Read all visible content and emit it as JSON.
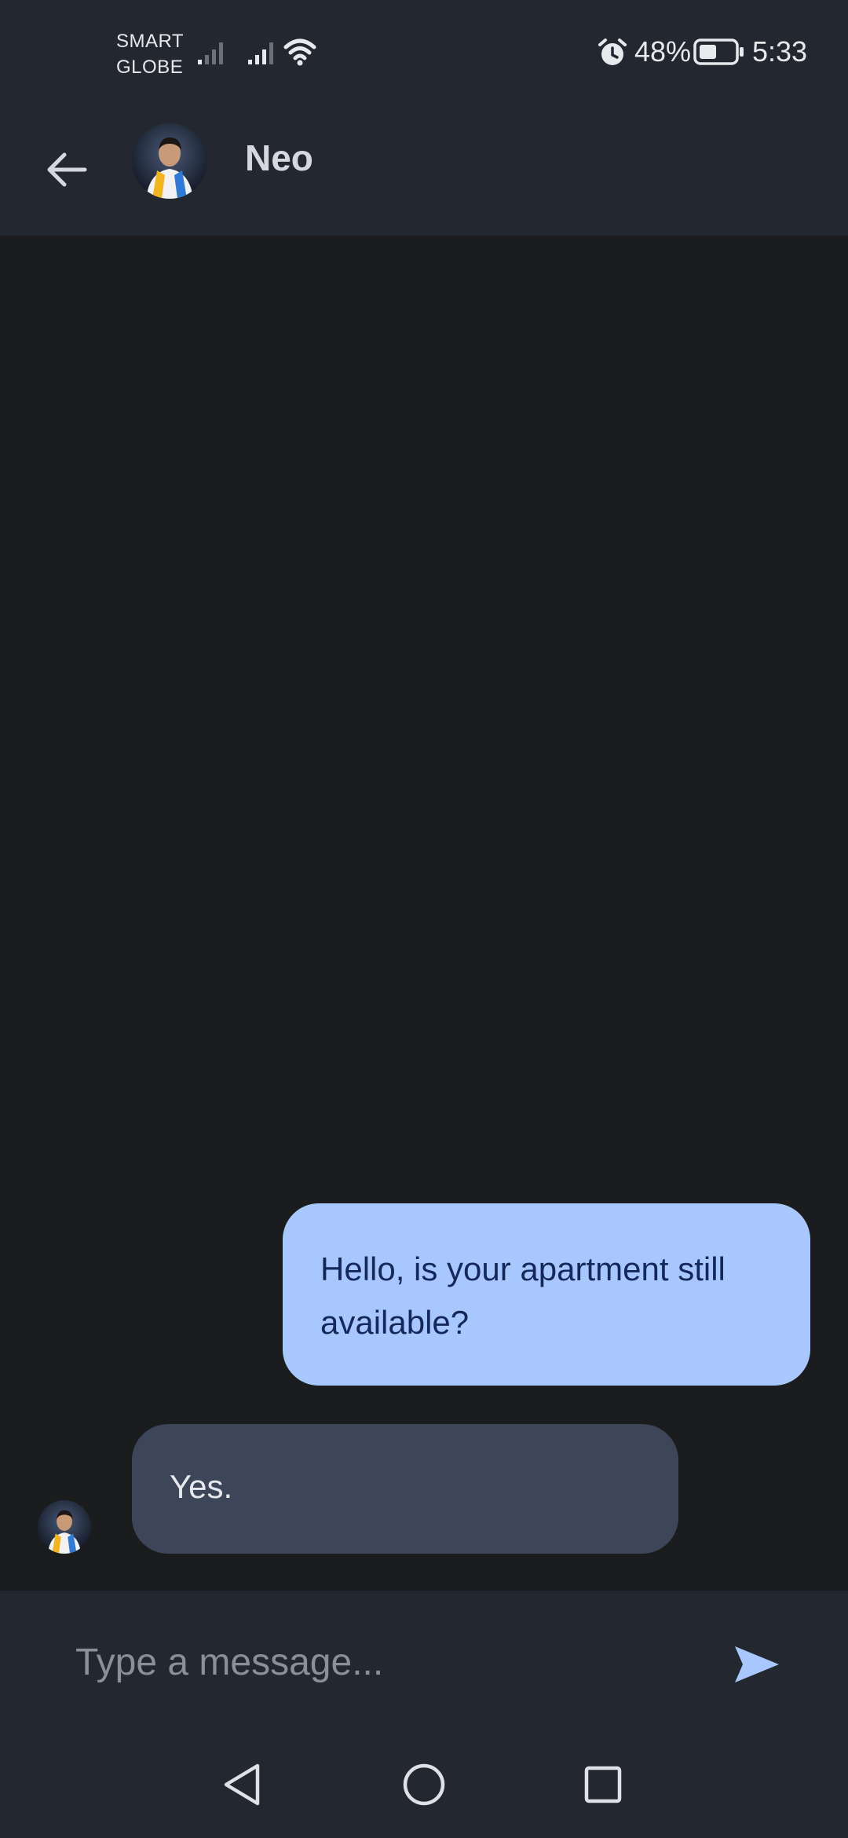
{
  "status_bar": {
    "carrier_line1": "SMART",
    "carrier_line2": "GLOBE",
    "battery_percent": "48%",
    "time": "5:33",
    "icons": [
      "signal-icon",
      "signal-icon",
      "wifi-icon",
      "alarm-icon",
      "battery-icon"
    ]
  },
  "header": {
    "back_icon": "arrow-left-icon",
    "contact_name": "Neo"
  },
  "messages": [
    {
      "direction": "outgoing",
      "text": "Hello, is your apartment still available?"
    },
    {
      "direction": "incoming",
      "text": "Yes."
    }
  ],
  "composer": {
    "placeholder": "Type a message...",
    "send_icon": "send-icon"
  },
  "nav_bar": {
    "icons": [
      "nav-back-icon",
      "nav-home-icon",
      "nav-recents-icon"
    ]
  },
  "colors": {
    "background": "#1b1c1e",
    "bars": "#232730",
    "outgoing_bubble": "#a9c7ff",
    "outgoing_text": "#14285a",
    "incoming_bubble": "#3d4658",
    "accent": "#a9c7ff"
  }
}
